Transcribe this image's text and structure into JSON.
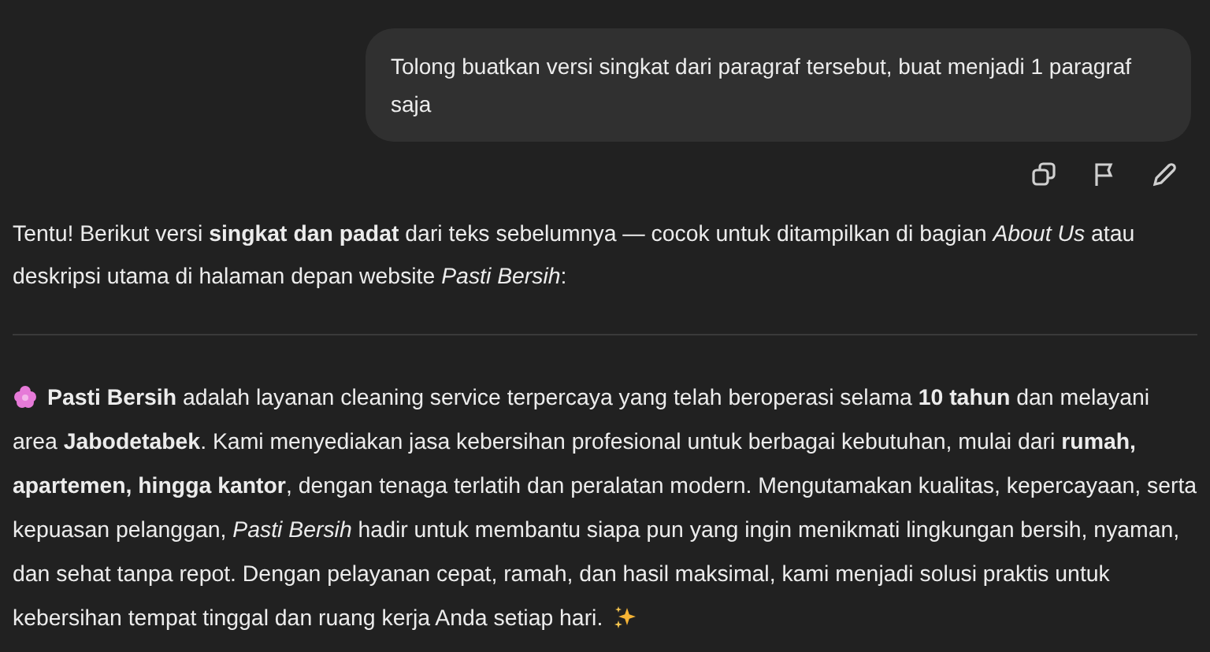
{
  "user_message": {
    "text": "Tolong buatkan versi singkat dari paragraf tersebut, buat menjadi 1 paragraf saja"
  },
  "response": {
    "intro": "Tentu! Berikut versi **singkat dan padat** dari teks sebelumnya — cocok untuk ditampilkan di bagian *About Us* atau deskripsi utama di halaman depan website *Pasti Bersih*:",
    "summary": "**Pasti Bersih** adalah layanan cleaning service terpercaya yang telah beroperasi selama **10 tahun** dan melayani area **Jabodetabek**. Kami menyediakan jasa kebersihan profesional untuk berbagai kebutuhan, mulai dari **rumah, apartemen, hingga kantor**, dengan tenaga terlatih dan peralatan modern. Mengutamakan kualitas, kepercayaan, serta kepuasan pelanggan, *Pasti Bersih* hadir untuk membantu siapa pun yang ingin menikmati lingkungan bersih, nyaman, dan sehat tanpa repot. Dengan pelayanan cepat, ramah, dan hasil maksimal, kami menjadi solusi praktis untuk kebersihan tempat tinggal dan ruang kerja Anda setiap hari."
  }
}
